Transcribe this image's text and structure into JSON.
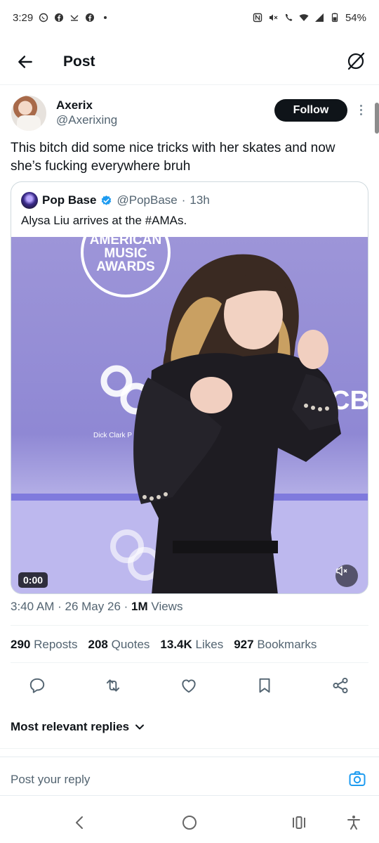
{
  "status_bar": {
    "time": "3:29",
    "battery": "54%"
  },
  "header": {
    "title": "Post"
  },
  "post": {
    "author_name": "Axerix",
    "author_handle": "@Axerixing",
    "follow_label": "Follow",
    "text": "This bitch did some nice tricks with her skates and now she’s fucking everywhere bruh"
  },
  "quote": {
    "name": "Pop Base",
    "handle": "@PopBase",
    "dot": "·",
    "time": "13h",
    "text": "Alysa Liu arrives at the #AMAs.",
    "media": {
      "logo_line1": "AMERICAN",
      "logo_line2": "MUSIC",
      "logo_line3": "AWARDS",
      "backdrop_text": "Dick Clark P",
      "backdrop_cbs": "CB",
      "duration": "0:00"
    }
  },
  "meta": {
    "time": "3:40 AM",
    "date": "26 May 26",
    "views_count": "1M",
    "views_label": "Views",
    "sep": "·"
  },
  "stats": [
    {
      "count": "290",
      "label": "Reposts"
    },
    {
      "count": "208",
      "label": "Quotes"
    },
    {
      "count": "13.4K",
      "label": "Likes"
    },
    {
      "count": "927",
      "label": "Bookmarks"
    }
  ],
  "sort": {
    "label": "Most relevant replies"
  },
  "reply": {
    "placeholder": "Post your reply"
  },
  "colors": {
    "accent": "#1d9bf0",
    "text": "#0f1419",
    "muted": "#536471"
  }
}
